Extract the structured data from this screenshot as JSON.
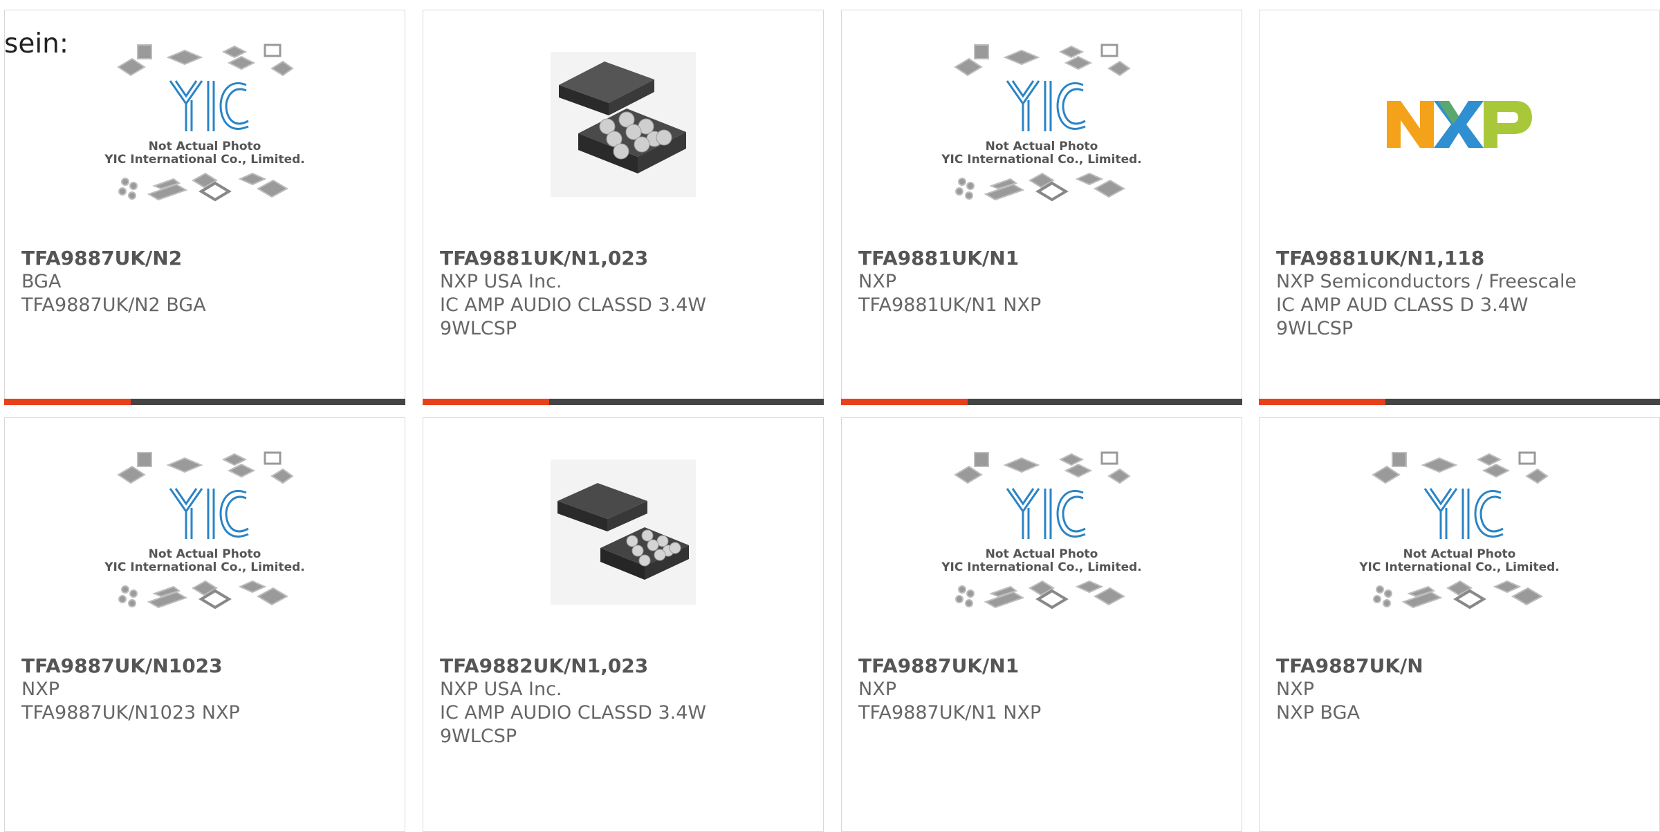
{
  "intro_text": "sein:",
  "placeholder_image": {
    "logo": "YIC",
    "caption_1": "Not Actual Photo",
    "caption_2": "YIC International Co., Limited."
  },
  "nxp_logo_text": "NXP",
  "colors": {
    "accent_bar": "#e8401a",
    "bar_dark": "#444444",
    "yic_logo_blue": "#2a84c6",
    "nxp_orange": "#f5a21b",
    "nxp_blue": "#2f8fd0",
    "nxp_green": "#a8c83a"
  },
  "products": [
    {
      "image": "placeholder",
      "part": "TFA9887UK/N2",
      "line1": "BGA",
      "line2": "TFA9887UK/N2 BGA",
      "line3": ""
    },
    {
      "image": "chip-9ball-closeup",
      "part": "TFA9881UK/N1,023",
      "line1": "NXP USA Inc.",
      "line2": "IC AMP AUDIO CLASSD 3.4W",
      "line3": "9WLCSP"
    },
    {
      "image": "placeholder",
      "part": "TFA9881UK/N1",
      "line1": "NXP",
      "line2": "TFA9881UK/N1 NXP",
      "line3": ""
    },
    {
      "image": "nxp-logo",
      "part": "TFA9881UK/N1,118",
      "line1": "NXP Semiconductors / Freescale",
      "line2": "IC AMP AUD CLASS D 3.4W",
      "line3": "9WLCSP"
    },
    {
      "image": "placeholder",
      "part": "TFA9887UK/N1023",
      "line1": "NXP",
      "line2": "TFA9887UK/N1023 NXP",
      "line3": ""
    },
    {
      "image": "chip-9ball-small",
      "part": "TFA9882UK/N1,023",
      "line1": "NXP USA Inc.",
      "line2": "IC AMP AUDIO CLASSD 3.4W",
      "line3": "9WLCSP"
    },
    {
      "image": "placeholder",
      "part": "TFA9887UK/N1",
      "line1": "NXP",
      "line2": "TFA9887UK/N1 NXP",
      "line3": ""
    },
    {
      "image": "placeholder",
      "part": "TFA9887UK/N",
      "line1": "NXP",
      "line2": "NXP BGA",
      "line3": ""
    }
  ]
}
